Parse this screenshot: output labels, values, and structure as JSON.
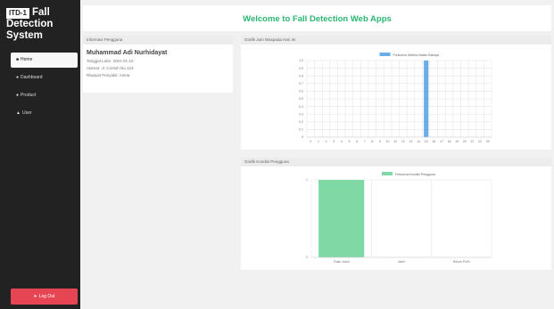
{
  "sidebar": {
    "logo_badge": "ITD-1",
    "logo_text": "Fall Detection System",
    "items": [
      {
        "label": "Home",
        "icon": "home-icon"
      },
      {
        "label": "Dashboard",
        "icon": "dashboard-icon"
      },
      {
        "label": "Product",
        "icon": "product-icon"
      },
      {
        "label": "User",
        "icon": "user-icon"
      }
    ],
    "logout_label": "Log Out",
    "colors": {
      "bg": "#222222",
      "logout": "#e64553"
    }
  },
  "header": {
    "title": "Welcome to Fall Detection Web Apps",
    "color": "#2bb673"
  },
  "user_card": {
    "title": "Informasi Pengguna",
    "name": "Muhammad Adi Nurhidayat",
    "line1": "Tanggal Lahir: 2001-01-10",
    "line2": "Alamat: Jl. Contoh No.123",
    "line3": "Riwayat Penyakit: Asma"
  },
  "chart_data": [
    {
      "type": "bar",
      "panel_title": "Grafik Jam Waspada Hari Ini",
      "legend": "Frekuensi Deteksi Waktu Bahaya",
      "color": "#6aaee8",
      "categories": [
        "0",
        "1",
        "2",
        "3",
        "4",
        "5",
        "6",
        "7",
        "8",
        "9",
        "10",
        "11",
        "12",
        "13",
        "14",
        "15",
        "16",
        "17",
        "18",
        "19",
        "20",
        "21",
        "22",
        "23"
      ],
      "values": [
        0,
        0,
        0,
        0,
        0,
        0,
        0,
        0,
        0,
        0,
        0,
        0,
        0,
        0,
        0,
        1,
        0,
        0,
        0,
        0,
        0,
        0,
        0,
        0
      ],
      "ylim": [
        0,
        1
      ],
      "yticks": [
        "0",
        "0.1",
        "0.2",
        "0.3",
        "0.4",
        "0.5",
        "0.6",
        "0.7",
        "0.8",
        "0.9",
        "1.0"
      ],
      "grid": true,
      "legend_position": "top"
    },
    {
      "type": "bar",
      "panel_title": "Grafik Kondisi Pengguna",
      "legend": "Frekuensi Kondisi Pengguna",
      "color": "#7ed9a4",
      "categories": [
        "Tidak Jatuh",
        "Jatuh",
        "Belum Pulih"
      ],
      "values": [
        1,
        0,
        0
      ],
      "ylim": [
        0,
        1
      ],
      "yticks": [
        "0",
        "1"
      ],
      "grid": true,
      "legend_position": "top"
    }
  ]
}
